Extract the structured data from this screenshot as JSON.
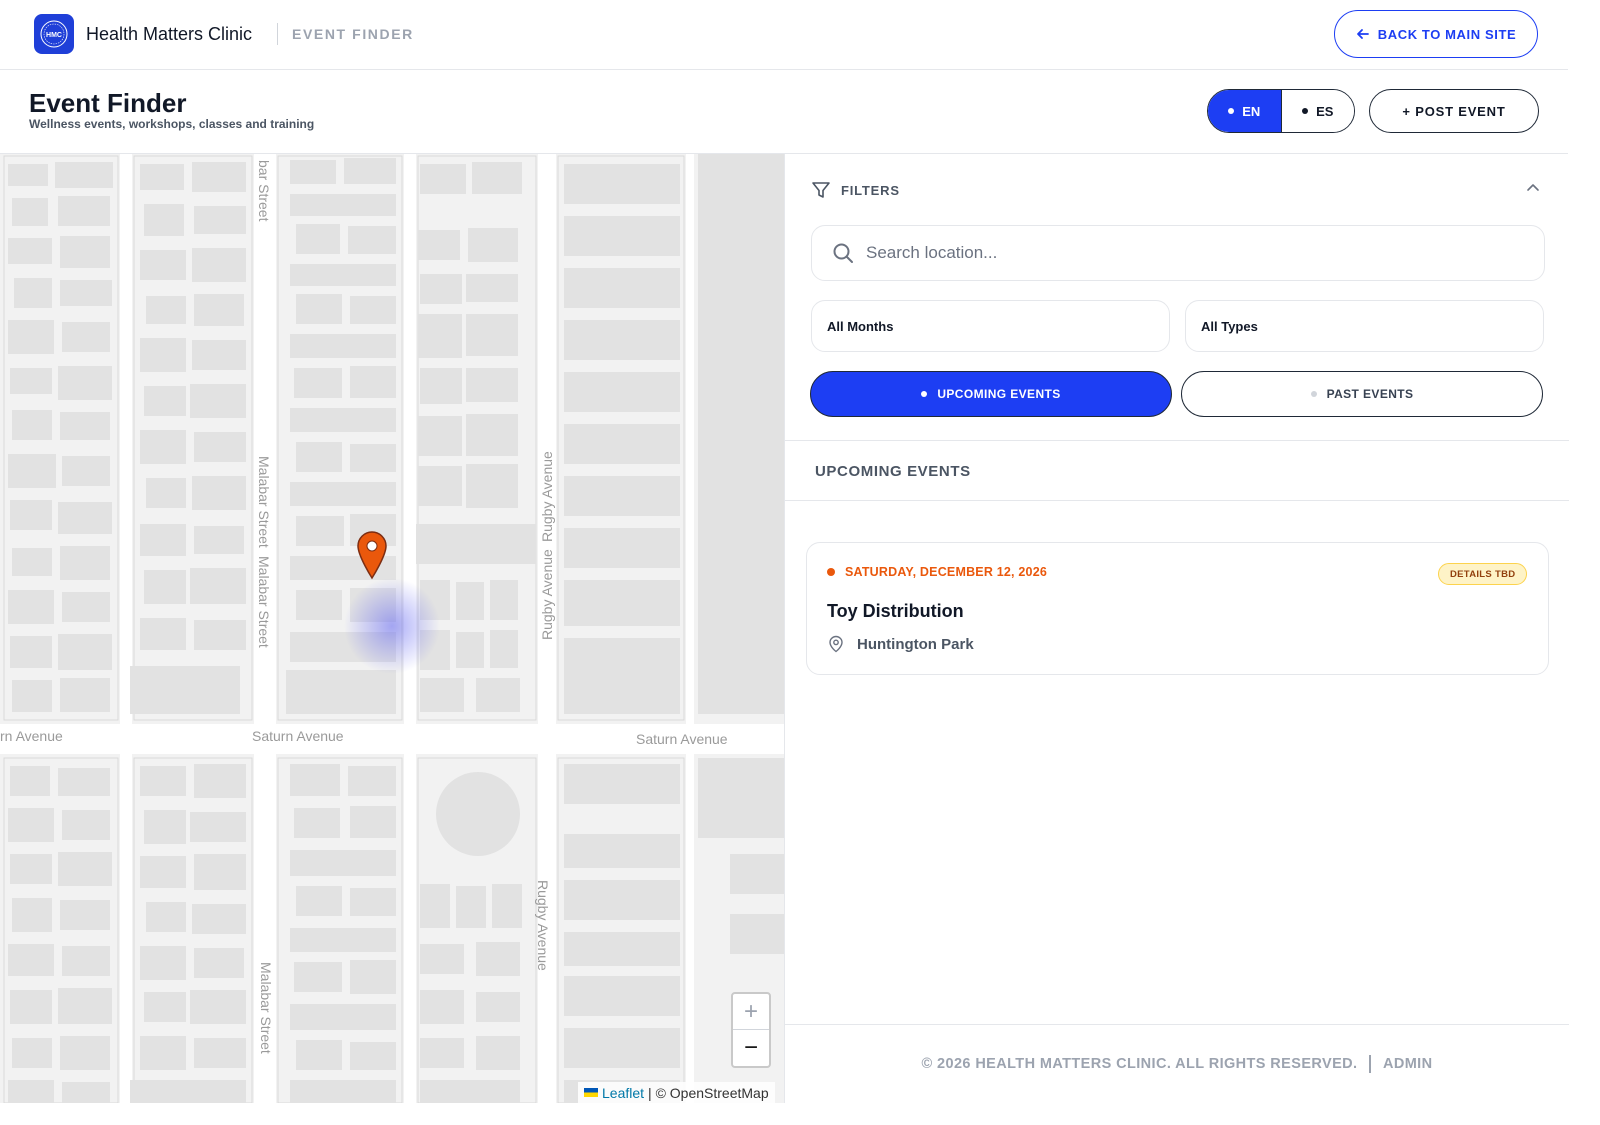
{
  "topbar": {
    "brand": "Health Matters Clinic",
    "section": "EVENT FINDER",
    "logo_text": "HMC",
    "back_label": "BACK TO MAIN SITE"
  },
  "header": {
    "title": "Event Finder",
    "subtitle": "Wellness events, workshops, classes and training",
    "languages": [
      {
        "label": "EN",
        "active": true
      },
      {
        "label": "ES",
        "active": false
      }
    ],
    "post_label": "+ POST EVENT"
  },
  "map": {
    "street_labels": [
      "bar Street",
      "Malabar Street",
      "Malabar Street",
      "Rugby Avenue",
      "Rugby Avenue",
      "rn Avenue",
      "Saturn Avenue",
      "Saturn Avenue",
      "Rugby Avenue",
      "Malabar Street"
    ],
    "zoom_in": "+",
    "zoom_out": "−",
    "attribution_link": "Leaflet",
    "attribution_text": "| © OpenStreetMap"
  },
  "filters": {
    "heading": "FILTERS",
    "search_placeholder": "Search location...",
    "month_select": "All Months",
    "type_select": "All Types",
    "toggle_upcoming": "UPCOMING EVENTS",
    "toggle_past": "PAST EVENTS"
  },
  "events": {
    "heading": "UPCOMING EVENTS",
    "items": [
      {
        "date": "SATURDAY, DECEMBER 12, 2026",
        "badge": "DETAILS TBD",
        "title": "Toy Distribution",
        "location": "Huntington Park"
      }
    ]
  },
  "footer": {
    "copyright": "© 2026 HEALTH MATTERS CLINIC. ALL RIGHTS RESERVED.",
    "admin": "ADMIN"
  },
  "colors": {
    "accent": "#1d3ef3",
    "date": "#ea580c",
    "badge_bg": "#fef3c7",
    "marker": "#ea580c"
  }
}
